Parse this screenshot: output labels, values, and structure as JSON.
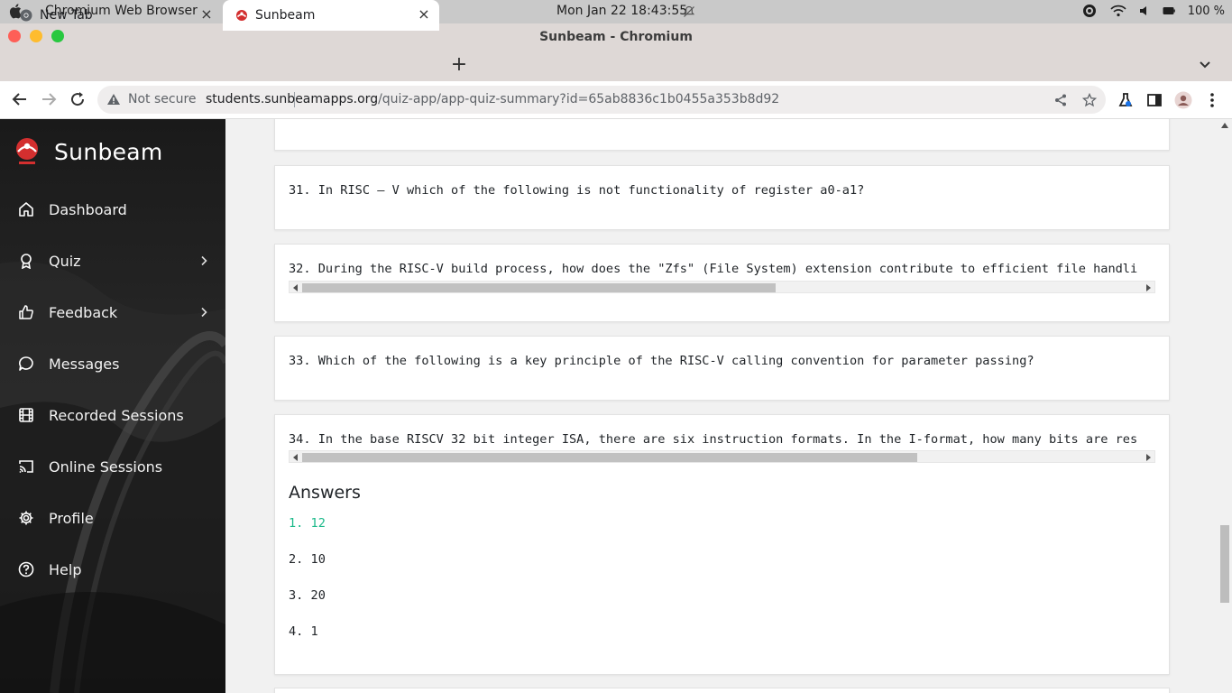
{
  "os": {
    "app_name": "Chromium Web Browser",
    "clock": "Mon Jan 22  18:43:55",
    "battery": "100 %"
  },
  "window": {
    "title": "Sunbeam - Chromium"
  },
  "tabs": [
    {
      "label": "New Tab",
      "active": false
    },
    {
      "label": "Sunbeam",
      "active": true
    }
  ],
  "omnibox": {
    "security": "Not secure",
    "url_host": "students.sunbeamapps.org",
    "url_path": "/quiz-app/app-quiz-summary?id=65ab8836c1b0455a353b8d92"
  },
  "sidebar": {
    "brand": "Sunbeam",
    "items": [
      {
        "label": "Dashboard",
        "icon": "home-icon",
        "has_submenu": false
      },
      {
        "label": "Quiz",
        "icon": "award-icon",
        "has_submenu": true
      },
      {
        "label": "Feedback",
        "icon": "thumbs-up-icon",
        "has_submenu": true
      },
      {
        "label": "Messages",
        "icon": "chat-icon",
        "has_submenu": false
      },
      {
        "label": "Recorded Sessions",
        "icon": "film-icon",
        "has_submenu": false
      },
      {
        "label": "Online Sessions",
        "icon": "cast-icon",
        "has_submenu": false
      },
      {
        "label": "Profile",
        "icon": "gear-icon",
        "has_submenu": false
      },
      {
        "label": "Help",
        "icon": "help-circle-icon",
        "has_submenu": false
      }
    ]
  },
  "questions": [
    {
      "text": "31. In RISC – V which of the following is not functionality of register a0-a1?"
    },
    {
      "text": "32. During the RISC-V build process, how does the \"Zfs\" (File System) extension contribute to efficient file handli"
    },
    {
      "text": "33. Which of the following is a key principle of the RISC-V calling convention for parameter passing?"
    },
    {
      "text": "34. In the base RISCV 32 bit integer ISA, there are six instruction formats. In the I-format, how many bits are res"
    }
  ],
  "answers_section": {
    "title": "Answers",
    "options": [
      {
        "text": "1. 12",
        "correct": true
      },
      {
        "text": "2. 10",
        "correct": false
      },
      {
        "text": "3. 20",
        "correct": false
      },
      {
        "text": "4. 1",
        "correct": false
      }
    ]
  },
  "colors": {
    "correct_answer": "#1cb98a",
    "sidebar_bg": "#1d1d1d",
    "main_bg": "#f1f1f1"
  }
}
